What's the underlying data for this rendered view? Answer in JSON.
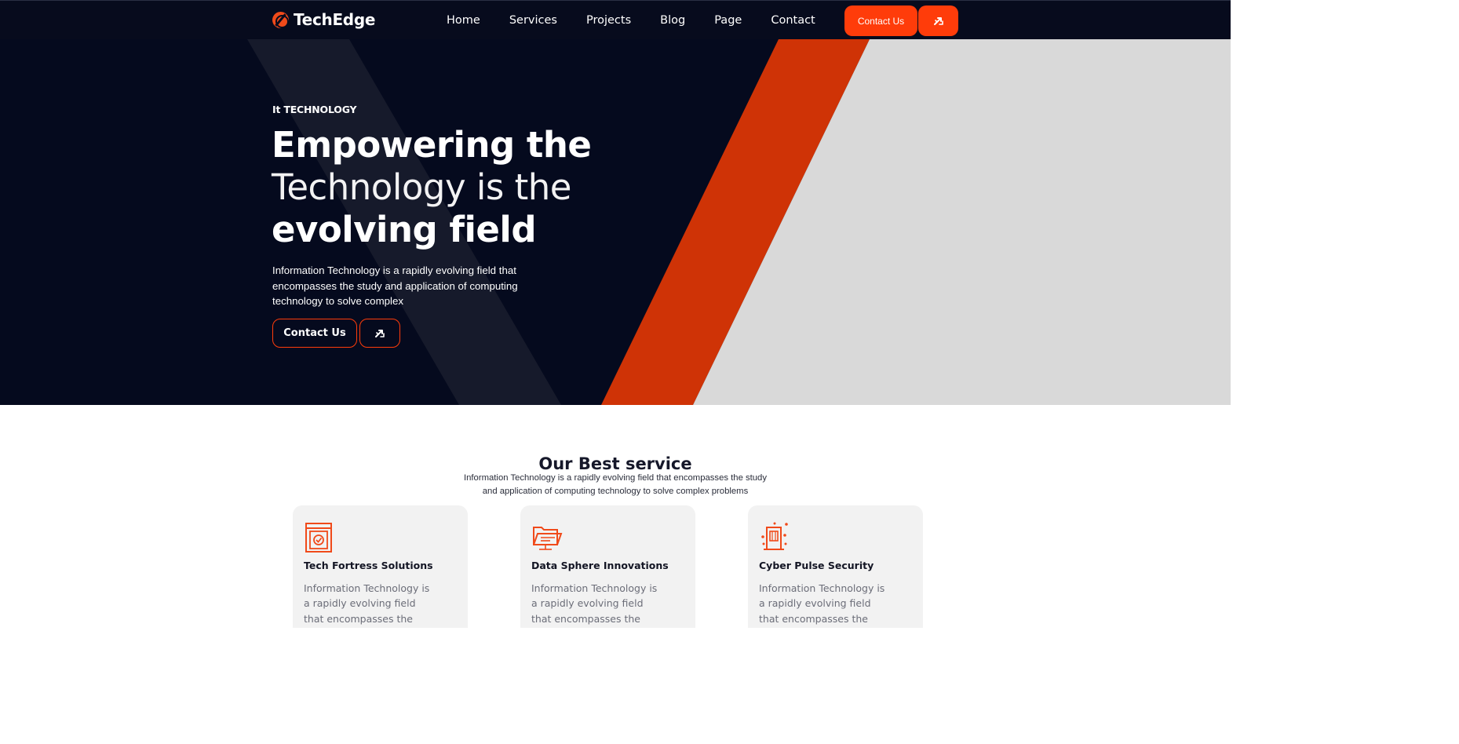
{
  "brand": {
    "name": "TechEdge",
    "accent_color": "#ff3c0a",
    "dark_color": "#050a1e"
  },
  "nav": {
    "items": [
      {
        "label": "Home"
      },
      {
        "label": "Services"
      },
      {
        "label": "Projects"
      },
      {
        "label": "Blog"
      },
      {
        "label": "Page"
      },
      {
        "label": "Contact"
      }
    ]
  },
  "header": {
    "contact_button": "Contact Us",
    "arrow_icon": "shuffle-arrows-icon"
  },
  "hero": {
    "eyebrow": "It TECHNOLOGY",
    "headline_line1": "Empowering the",
    "headline_line2": "Technology is the",
    "headline_line3": "evolving field",
    "description": "Information Technology is a rapidly evolving field that encompasses the study and application of computing technology to solve complex",
    "contact_button": "Contact Us",
    "arrow_icon": "shuffle-arrows-icon"
  },
  "services": {
    "title": "Our Best service",
    "subtitle": "Information Technology is a rapidly evolving field that encompasses the study and application of computing technology to solve complex problems",
    "cards": [
      {
        "title": "Tech Fortress Solutions",
        "description": "Information Technology is a rapidly evolving field that encompasses the study",
        "icon": "secure-window-icon"
      },
      {
        "title": "Data Sphere Innovations",
        "description": "Information Technology is a rapidly evolving field that encompasses the study",
        "icon": "data-folder-icon"
      },
      {
        "title": "Cyber Pulse Security",
        "description": "Information Technology is a rapidly evolving field that encompasses the study",
        "icon": "secure-building-icon"
      }
    ]
  }
}
